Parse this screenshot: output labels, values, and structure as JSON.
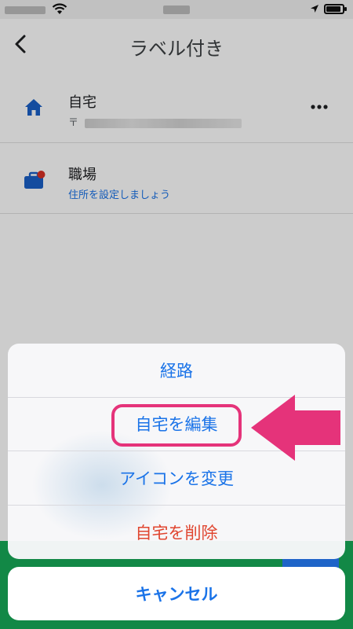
{
  "header": {
    "title": "ラベル付き"
  },
  "list": {
    "items": [
      {
        "name": "自宅",
        "sub": "〒"
      },
      {
        "name": "職場",
        "sub": "住所を設定しましょう"
      }
    ]
  },
  "action_sheet": {
    "items": [
      {
        "label": "経路"
      },
      {
        "label": "自宅を編集"
      },
      {
        "label": "アイコンを変更"
      },
      {
        "label": "自宅を削除"
      }
    ],
    "cancel_label": "キャンセル"
  },
  "colors": {
    "accent": "#1a73e8",
    "danger": "#e0452f",
    "annotation": "#e5337a"
  },
  "icons": {
    "home": "home-icon",
    "work": "briefcase-icon",
    "more": "more-icon",
    "back": "back-arrow-icon"
  }
}
